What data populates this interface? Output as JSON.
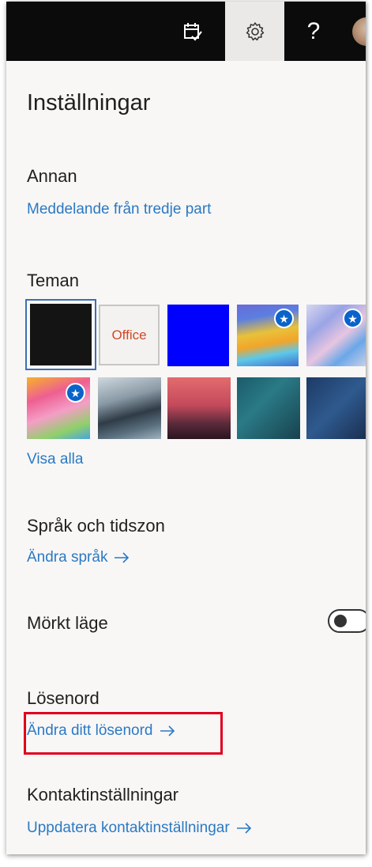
{
  "topbar": {
    "icons": [
      "calendar-check-icon",
      "gear-icon",
      "help-icon",
      "avatar"
    ],
    "help_label": "?"
  },
  "panel": {
    "title": "Inställningar",
    "annan": {
      "heading": "Annan",
      "link": "Meddelande från tredje part"
    },
    "teman": {
      "heading": "Teman",
      "office_label": "Office",
      "view_all": "Visa alla",
      "selected_index": 0
    },
    "language": {
      "heading": "Språk och tidszon",
      "link": "Ändra språk"
    },
    "dark_mode": {
      "heading": "Mörkt läge",
      "on": false
    },
    "password": {
      "heading": "Lösenord",
      "link": "Ändra ditt lösenord"
    },
    "contact": {
      "heading": "Kontaktinställningar",
      "link": "Uppdatera kontaktinställningar"
    }
  },
  "colors": {
    "topbar": "#0b0b0b",
    "link": "#2b79c4",
    "highlight": "#e0001b",
    "selected_theme_border": "#3c6fb5"
  }
}
